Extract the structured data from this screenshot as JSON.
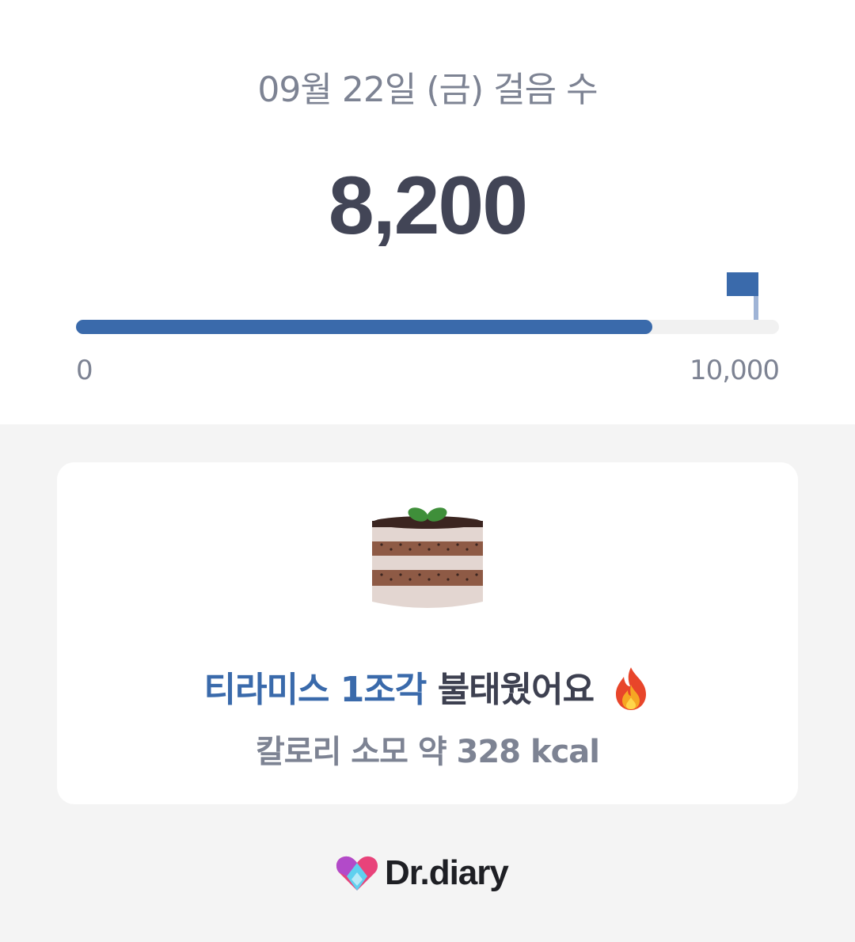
{
  "header": {
    "date_title": "09월 22일 (금) 걸음 수",
    "step_count": "8,200"
  },
  "progress": {
    "min_label": "0",
    "max_label": "10,000",
    "current": 8200,
    "goal": 10000,
    "fill_color": "#3a6aab",
    "track_color": "#f1f1f1"
  },
  "card": {
    "food_icon": "tiramisu-cake-icon",
    "burn_highlight": "티라미스 1조각",
    "burn_rest": "불태웠어요",
    "burn_emoji_icon": "fire-icon",
    "calorie_text": "칼로리 소모 약 328 kcal"
  },
  "brand": {
    "logo_icon": "dr-diary-heart-logo",
    "name": "Dr.diary"
  },
  "colors": {
    "accent": "#3a6aab",
    "muted_text": "#7d8393",
    "dark_text": "#424556",
    "background": "#f4f4f4"
  }
}
